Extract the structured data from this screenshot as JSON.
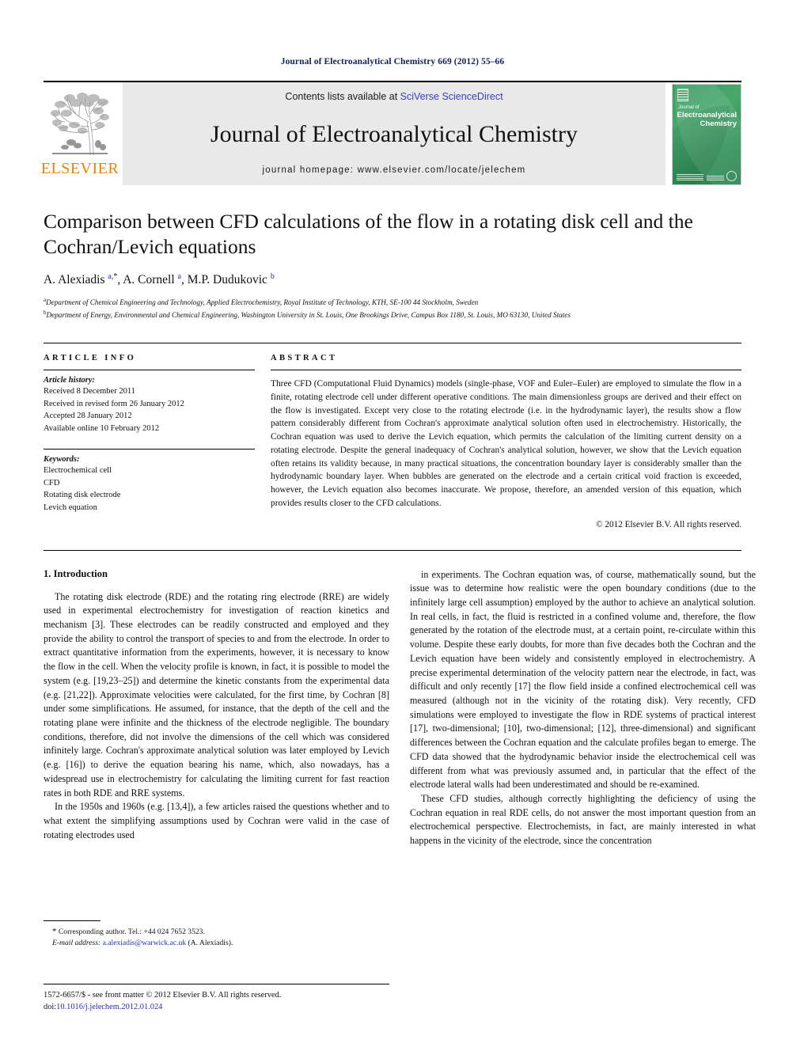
{
  "running_head": "Journal of Electroanalytical Chemistry 669 (2012) 55–66",
  "masthead": {
    "publisher_name": "ELSEVIER",
    "contents_prefix": "Contents lists available at ",
    "sciencedirect_link": "SciVerse ScienceDirect",
    "journal_title": "Journal of Electroanalytical Chemistry",
    "homepage": "journal homepage: www.elsevier.com/locate/jelechem",
    "cover": {
      "line1": "Journal of",
      "line2": "Electroanalytical",
      "line3": "Chemistry"
    }
  },
  "title": "Comparison between CFD calculations of the flow in a rotating disk cell and the Cochran/Levich equations",
  "authors": {
    "a1_name": "A. Alexiadis ",
    "a1_sup": "a,",
    "a1_star": "*",
    "a2_name": ", A. Cornell ",
    "a2_sup": "a",
    "a3_name": ", M.P. Dudukovic ",
    "a3_sup": "b"
  },
  "affiliations": [
    {
      "marker": "a",
      "text": "Department of Chemical Engineering and Technology, Applied Electrochemistry, Royal Institute of Technology, KTH, SE-100 44 Stockholm, Sweden"
    },
    {
      "marker": "b",
      "text": "Department of Energy, Environmental and Chemical Engineering, Washington University in St. Louis, One Brookings Drive, Campus Box 1180, St. Louis, MO 63130, United States"
    }
  ],
  "article_info": {
    "heading": "ARTICLE INFO",
    "history_label": "Article history:",
    "history": [
      "Received 8 December 2011",
      "Received in revised form 26 January 2012",
      "Accepted 28 January 2012",
      "Available online 10 February 2012"
    ],
    "keywords_label": "Keywords:",
    "keywords": [
      "Electrochemical cell",
      "CFD",
      "Rotating disk electrode",
      "Levich equation"
    ]
  },
  "abstract": {
    "heading": "ABSTRACT",
    "text": "Three CFD (Computational Fluid Dynamics) models (single-phase, VOF and Euler–Euler) are employed to simulate the flow in a finite, rotating electrode cell under different operative conditions. The main dimensionless groups are derived and their effect on the flow is investigated. Except very close to the rotating electrode (i.e. in the hydrodynamic layer), the results show a flow pattern considerably different from Cochran's approximate analytical solution often used in electrochemistry. Historically, the Cochran equation was used to derive the Levich equation, which permits the calculation of the limiting current density on a rotating electrode. Despite the general inadequacy of Cochran's analytical solution, however, we show that the Levich equation often retains its validity because, in many practical situations, the concentration boundary layer is considerably smaller than the hydrodynamic boundary layer. When bubbles are generated on the electrode and a certain critical void fraction is exceeded, however, the Levich equation also becomes inaccurate. We propose, therefore, an amended version of this equation, which provides results closer to the CFD calculations.",
    "copyright": "© 2012 Elsevier B.V. All rights reserved."
  },
  "body": {
    "section_heading": "1. Introduction",
    "left_paragraphs": [
      "The rotating disk electrode (RDE) and the rotating ring electrode (RRE) are widely used in experimental electrochemistry for investigation of reaction kinetics and mechanism [3]. These electrodes can be readily constructed and employed and they provide the ability to control the transport of species to and from the electrode. In order to extract quantitative information from the experiments, however, it is necessary to know the flow in the cell. When the velocity profile is known, in fact, it is possible to model the system (e.g. [19,23–25]) and determine the kinetic constants from the experimental data (e.g. [21,22]). Approximate velocities were calculated, for the first time, by Cochran [8] under some simplifications. He assumed, for instance, that the depth of the cell and the rotating plane were infinite and the thickness of the electrode negligible. The boundary conditions, therefore, did not involve the dimensions of the cell which was considered infinitely large. Cochran's approximate analytical solution was later employed by Levich (e.g. [16]) to derive the equation bearing his name, which, also nowadays, has a widespread use in electrochemistry for calculating the limiting current for fast reaction rates in both RDE and RRE systems.",
      "In the 1950s and 1960s (e.g. [13,4]), a few articles raised the questions whether and to what extent the simplifying assumptions used by Cochran were valid in the case of rotating electrodes used"
    ],
    "right_paragraphs": [
      "in experiments. The Cochran equation was, of course, mathematically sound, but the issue was to determine how realistic were the open boundary conditions (due to the infinitely large cell assumption) employed by the author to achieve an analytical solution. In real cells, in fact, the fluid is restricted in a confined volume and, therefore, the flow generated by the rotation of the electrode must, at a certain point, re-circulate within this volume. Despite these early doubts, for more than five decades both the Cochran and the Levich equation have been widely and consistently employed in electrochemistry. A precise experimental determination of the velocity pattern near the electrode, in fact, was difficult and only recently [17] the flow field inside a confined electrochemical cell was measured (although not in the vicinity of the rotating disk). Very recently, CFD simulations were employed to investigate the flow in RDE systems of practical interest [17], two-dimensional; [10], two-dimensional; [12], three-dimensional) and significant differences between the Cochran equation and the calculate profiles began to emerge. The CFD data showed that the hydrodynamic behavior inside the electrochemical cell was different from what was previously assumed and, in particular that the effect of the electrode lateral walls had been underestimated and should be re-examined.",
      "These CFD studies, although correctly highlighting the deficiency of using the Cochran equation in real RDE cells, do not answer the most important question from an electrochemical perspective. Electrochemists, in fact, are mainly interested in what happens in the vicinity of the electrode, since the concentration"
    ]
  },
  "footnote": {
    "star": "*",
    "corresponding": " Corresponding author. Tel.: +44 024 7652 3523.",
    "email_label": "E-mail address:",
    "email": "a.alexiadis@warwick.ac.uk",
    "email_suffix": " (A. Alexiadis)."
  },
  "page_footer": {
    "line1": "1572-6657/$ - see front matter © 2012 Elsevier B.V. All rights reserved.",
    "doi_label": "doi:",
    "doi": "10.1016/j.jelechem.2012.01.024"
  },
  "colors": {
    "running_head": "#12215c",
    "link": "#2a2ab4",
    "elsevier_orange": "#ef8200",
    "journal_band": "#e9e9e9",
    "cover_green": "#3d9b63"
  }
}
